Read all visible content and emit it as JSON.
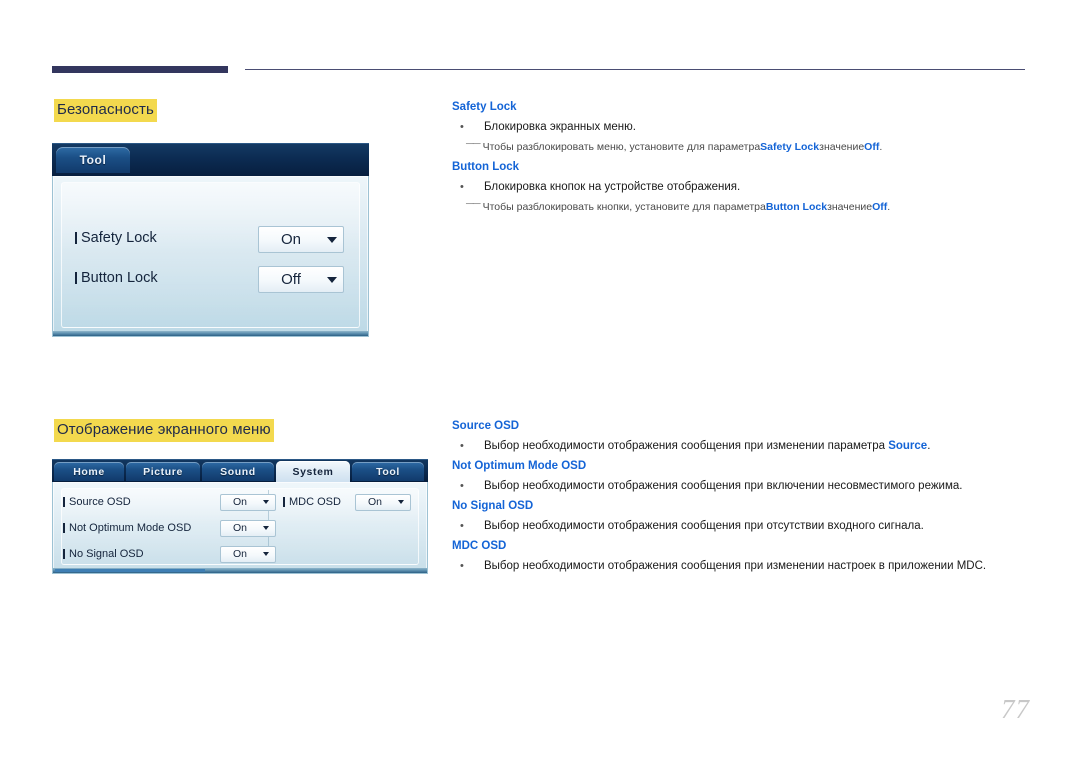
{
  "page": {
    "number": "77"
  },
  "sections": [
    {
      "heading": "Безопасность",
      "osd": {
        "tabs": [
          {
            "label": "Tool",
            "active": false
          }
        ],
        "rows": [
          {
            "label": "Safety Lock",
            "value": "On"
          },
          {
            "label": "Button Lock",
            "value": "Off"
          }
        ]
      },
      "entries": [
        {
          "term": "Safety Lock",
          "bullet": "Блокировка экранных меню.",
          "note_pre": "Чтобы разблокировать меню, установите для параметра ",
          "note_hl1": "Safety Lock",
          "note_mid": " значение ",
          "note_hl2": "Off",
          "note_end": "."
        },
        {
          "term": "Button Lock",
          "bullet": "Блокировка кнопок на устройстве отображения.",
          "note_pre": "Чтобы разблокировать кнопки, установите для параметра ",
          "note_hl1": "Button Lock",
          "note_mid": " значение ",
          "note_hl2": "Off",
          "note_end": "."
        }
      ]
    },
    {
      "heading": "Отображение экранного меню",
      "osd": {
        "tabs": [
          {
            "label": "Home",
            "active": false
          },
          {
            "label": "Picture",
            "active": false
          },
          {
            "label": "Sound",
            "active": false
          },
          {
            "label": "System",
            "active": true
          },
          {
            "label": "Tool",
            "active": false
          }
        ],
        "rows_left": [
          {
            "label": "Source OSD",
            "value": "On"
          },
          {
            "label": "Not Optimum Mode OSD",
            "value": "On"
          },
          {
            "label": "No Signal OSD",
            "value": "On"
          }
        ],
        "rows_right": [
          {
            "label": "MDC OSD",
            "value": "On"
          }
        ]
      },
      "entries": [
        {
          "term": "Source OSD",
          "bullet_pre": "Выбор необходимости отображения сообщения при изменении параметра ",
          "bullet_hl": "Source",
          "bullet_end": "."
        },
        {
          "term": "Not Optimum Mode OSD",
          "bullet": "Выбор необходимости отображения сообщения при включении несовместимого режима."
        },
        {
          "term": "No Signal OSD",
          "bullet": "Выбор необходимости отображения сообщения при отсутствии входного сигнала."
        },
        {
          "term": "MDC OSD",
          "bullet": "Выбор необходимости отображения сообщения при изменении настроек в приложении MDC."
        }
      ]
    }
  ],
  "colors": {
    "accent_blue": "#1464d6",
    "highlight_yellow": "#f3d94e",
    "rule_navy": "#33365e"
  }
}
